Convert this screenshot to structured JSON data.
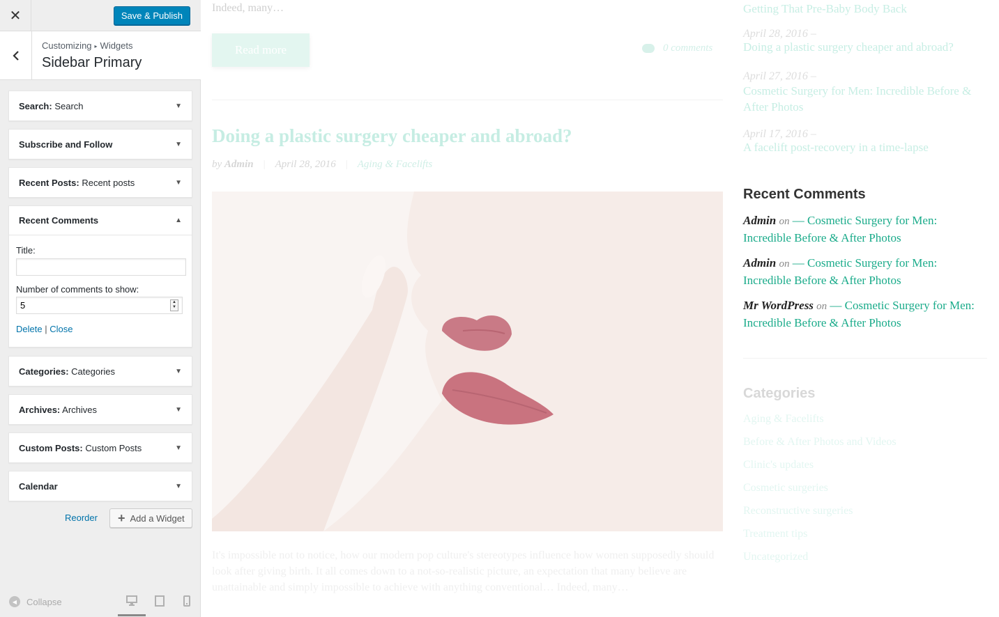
{
  "header": {
    "close_symbol": "✕",
    "publish_label": "Save & Publish"
  },
  "section": {
    "breadcrumb_root": "Customizing",
    "breadcrumb_sep": "▸",
    "breadcrumb_child": "Widgets",
    "title": "Sidebar Primary"
  },
  "widgets": [
    {
      "type": "Search:",
      "title": "Search"
    },
    {
      "type": "Subscribe and Follow",
      "title": ""
    },
    {
      "type": "Recent Posts:",
      "title": "Recent posts"
    },
    {
      "type": "Recent Comments",
      "title": ""
    },
    {
      "type": "Categories:",
      "title": "Categories"
    },
    {
      "type": "Archives:",
      "title": "Archives"
    },
    {
      "type": "Custom Posts:",
      "title": "Custom Posts"
    },
    {
      "type": "Calendar",
      "title": ""
    }
  ],
  "recent_comments_form": {
    "title_label": "Title:",
    "title_value": "",
    "count_label": "Number of comments to show:",
    "count_value": "5",
    "delete_label": "Delete",
    "separator": "|",
    "close_label": "Close"
  },
  "panel_actions": {
    "reorder_label": "Reorder",
    "add_widget_label": "Add a Widget",
    "collapse_label": "Collapse"
  },
  "preview": {
    "excerpt_top": "Indeed, many…",
    "read_more": "Read more",
    "comments_count": "0 comments",
    "post_title": "Doing a plastic surgery cheaper and abroad?",
    "post_author_prefix": "by",
    "post_author": "Admin",
    "post_date": "April 28, 2016",
    "post_category": "Aging & Facelifts",
    "post_text": "It's impossible not to notice, how our modern pop culture's stereotypes influence how women supposedly should look after giving birth. It all comes down to a not-so-realistic picture, an expectation that many believe are unattainable and simply impossible to achieve with anything conventional… Indeed, many…",
    "sidebar_recent": [
      {
        "date": "",
        "title": "Getting That Pre-Baby Body Back"
      },
      {
        "date": "April 28, 2016 –",
        "title": "Doing a plastic surgery cheaper and abroad?"
      },
      {
        "date": "April 27, 2016 –",
        "title": "Cosmetic Surgery for Men: Incredible Before & After Photos"
      },
      {
        "date": "April 17, 2016 –",
        "title": "A facelift post-recovery in a time-lapse"
      }
    ],
    "recent_comments_heading": "Recent Comments",
    "recent_comments": [
      {
        "author": "Admin",
        "on": "on",
        "dash": "—",
        "post": "Cosmetic Surgery for Men: Incredible Before & After Photos"
      },
      {
        "author": "Admin",
        "on": "on",
        "dash": "—",
        "post": "Cosmetic Surgery for Men: Incredible Before & After Photos"
      },
      {
        "author": "Mr WordPress",
        "on": "on",
        "dash": "—",
        "post": "Cosmetic Surgery for Men: Incredible Before & After Photos"
      }
    ],
    "categories_heading": "Categories",
    "categories": [
      "Aging & Facelifts",
      "Before & After Photos and Videos",
      "Clinic's updates",
      "Cosmetic surgeries",
      "Reconstructive surgeries",
      "Treatment tips",
      "Uncategorized"
    ]
  },
  "colors": {
    "publish_blue": "#0085ba",
    "link_blue": "#0073aa",
    "accent_teal": "#1aab8a"
  },
  "icons": {
    "close": "close-icon",
    "back": "chevron-left-icon",
    "expand": "triangle-down-icon",
    "collapse_widget": "triangle-up-icon",
    "add": "plus-icon",
    "collapse_panel": "collapse-arrow-icon",
    "desktop": "desktop-icon",
    "tablet": "tablet-icon",
    "mobile": "mobile-icon",
    "comment": "comment-bubble-icon"
  }
}
